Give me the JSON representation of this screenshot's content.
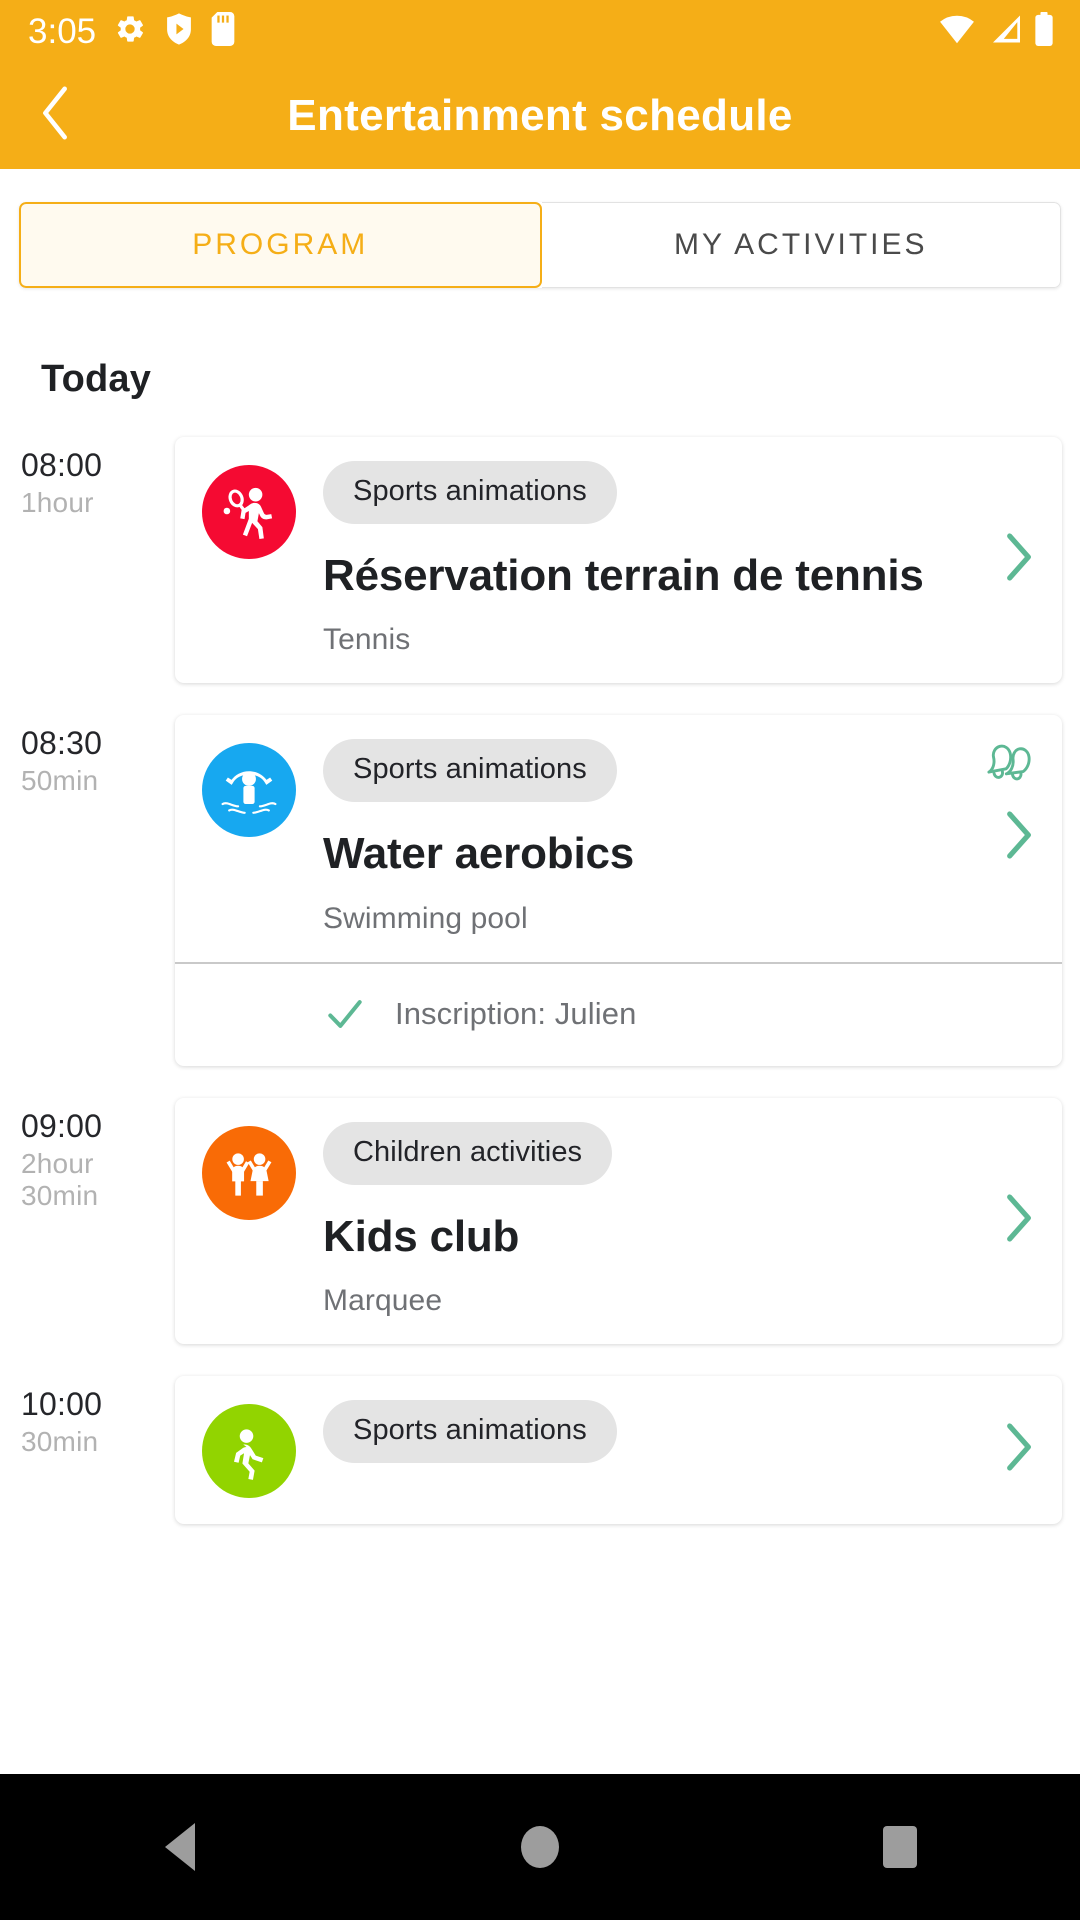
{
  "status_bar": {
    "clock": "3:05",
    "icons": [
      "gear-icon",
      "shield-play-icon",
      "sd-card-icon"
    ],
    "right_icons": [
      "wifi-icon",
      "cell-signal-icon",
      "battery-icon"
    ]
  },
  "app_bar": {
    "back_icon": "chevron-left-icon",
    "title": "Entertainment schedule",
    "background": "#F5AE17"
  },
  "tabs": [
    {
      "label": "PROGRAM",
      "active": true
    },
    {
      "label": "MY ACTIVITIES",
      "active": false
    }
  ],
  "day_heading": "Today",
  "colors": {
    "brand": "#F5AE17",
    "chevron": "#5DB894",
    "check": "#5DB894",
    "bell": "#5DB894"
  },
  "events": [
    {
      "time": "08:00",
      "duration": "1hour",
      "icon": "tennis-icon",
      "icon_color": "#F50A32",
      "category": "Sports animations",
      "title": "Réservation terrain de tennis",
      "place": "Tennis",
      "has_bell": false,
      "footer": null
    },
    {
      "time": "08:30",
      "duration": "50min",
      "icon": "water-aerobics-icon",
      "icon_color": "#17A8F0",
      "category": "Sports animations",
      "title": "Water aerobics",
      "place": "Swimming pool",
      "has_bell": true,
      "bell_icon": "bells-icon",
      "footer": {
        "check_icon": "check-icon",
        "text": "Inscription: Julien"
      }
    },
    {
      "time": "09:00",
      "duration": "2hour\n30min",
      "icon": "children-icon",
      "icon_color": "#F96B06",
      "category": "Children activities",
      "title": "Kids club",
      "place": "Marquee",
      "has_bell": false,
      "footer": null
    },
    {
      "time": "10:00",
      "duration": "30min",
      "icon": "sports-icon",
      "icon_color": "#92D400",
      "category": "Sports animations",
      "title": "",
      "place": "",
      "has_bell": false,
      "footer": null
    }
  ],
  "nav_bar": {
    "back": "back-triangle-icon",
    "home": "home-circle-icon",
    "recents": "recents-square-icon"
  }
}
